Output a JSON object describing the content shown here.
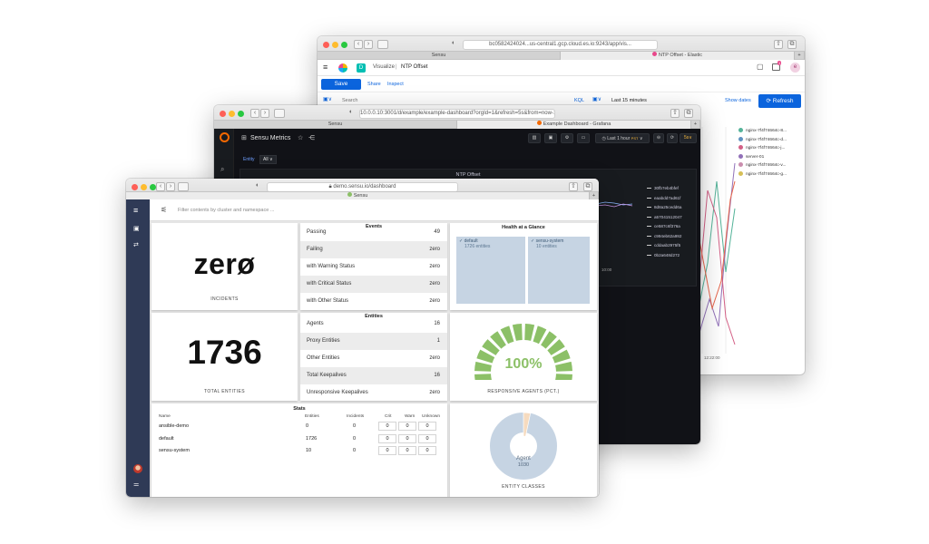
{
  "colors": {
    "sensu_sidebar": "#2f3a56",
    "kibana_blue": "#0b64dd",
    "gauge_green": "#8cc067",
    "health_tile": "#c6d4e3",
    "grafana_bg": "#111217"
  },
  "kibana": {
    "url": "bc0582424024...us-central1.gcp.cloud.es.io:9243/app/vis...",
    "tabs": [
      "Sensu",
      "NTP Offset - Elastic"
    ],
    "breadcrumb_root": "Visualize",
    "breadcrumb_current": "NTP Offset",
    "save_label": "Save",
    "share_label": "Share",
    "inspect_label": "Inspect",
    "search_placeholder": "Search",
    "kql_label": "KQL",
    "time_range": "Last 15 minutes",
    "show_dates_label": "Show dates",
    "refresh_label": "Refresh",
    "avatar_letter": "e",
    "notification_count": "1",
    "legend": [
      {
        "label": "nginx-7f4f74664c-8...",
        "color": "#54b399"
      },
      {
        "label": "nginx-7f4f74664c-d...",
        "color": "#6092c0"
      },
      {
        "label": "nginx-7f4f74664c-j...",
        "color": "#d36086"
      },
      {
        "label": "server-01",
        "color": "#9170b8"
      },
      {
        "label": "nginx-7f4f74664c-v...",
        "color": "#ca8eae"
      },
      {
        "label": "nginx-7f4f74664c-g...",
        "color": "#d6bf57"
      }
    ],
    "x_tick": "12:22:00"
  },
  "grafana": {
    "url": "10.0.0.10:3001/d/example/example-dashboard?orgId=1&refresh=5s&from=now-1h&to=...",
    "tabs": [
      "Sensu",
      "Example Dashboard - Grafana"
    ],
    "dashboard_title": "Sensu Metrics",
    "entity_label": "Entity",
    "entity_value": "All",
    "time_range": "Last 1 hour",
    "time_zone": "PST",
    "refresh_interval": "5s",
    "panel_title": "NTP Offset",
    "x_tick": "10:00",
    "legend": [
      "30fb7eb4bfef",
      "eaabdd7ad61f",
      "8d8a25cedd6a",
      "a57041512047",
      "ce587c6f376a",
      "c994eb62a992",
      "cddaab2975f5",
      "0b2a648d272"
    ]
  },
  "sensu": {
    "url": "demo.sensu.io/dashboard",
    "tab": "Sensu",
    "filter_placeholder": "Filter contents by cluster and namespace ...",
    "incidents_value": "zerø",
    "incidents_caption": "INCIDENTS",
    "entities_value": "1736",
    "entities_caption": "TOTAL ENTITIES",
    "events": {
      "title": "Events",
      "rows": [
        {
          "label": "Passing",
          "value": "49"
        },
        {
          "label": "Failing",
          "value": "zero"
        },
        {
          "label": "with Warning Status",
          "value": "zero"
        },
        {
          "label": "with Critical Status",
          "value": "zero"
        },
        {
          "label": "with Other Status",
          "value": "zero"
        }
      ]
    },
    "entities": {
      "title": "Entities",
      "rows": [
        {
          "label": "Agents",
          "value": "16"
        },
        {
          "label": "Proxy Entities",
          "value": "1"
        },
        {
          "label": "Other Entities",
          "value": "zero"
        },
        {
          "label": "Total Keepalives",
          "value": "16"
        },
        {
          "label": "Unresponsive Keepalives",
          "value": "zero"
        }
      ]
    },
    "health": {
      "title": "Health at a Glance",
      "tiles": [
        {
          "name": "default",
          "count": "1726 entities"
        },
        {
          "name": "sensu-system",
          "count": "10 entities"
        }
      ]
    },
    "responsive": {
      "value": "100%",
      "caption": "RESPONSIVE AGENTS (PCT.)",
      "fraction": 1.0
    },
    "stats": {
      "title": "Stats",
      "headers": [
        "Name",
        "Entities",
        "Incidents",
        "Crit",
        "Warn",
        "Unknown"
      ],
      "rows": [
        {
          "name": "ansible-demo",
          "entities": "0",
          "incidents": "0",
          "crit": "0",
          "warn": "0",
          "unknown": "0"
        },
        {
          "name": "default",
          "entities": "1726",
          "incidents": "0",
          "crit": "0",
          "warn": "0",
          "unknown": "0"
        },
        {
          "name": "sensu-system",
          "entities": "10",
          "incidents": "0",
          "crit": "0",
          "warn": "0",
          "unknown": "0"
        }
      ]
    },
    "entity_classes": {
      "caption": "ENTITY CLASSES",
      "slice_label": "Agent",
      "slice_value": "1030"
    }
  }
}
